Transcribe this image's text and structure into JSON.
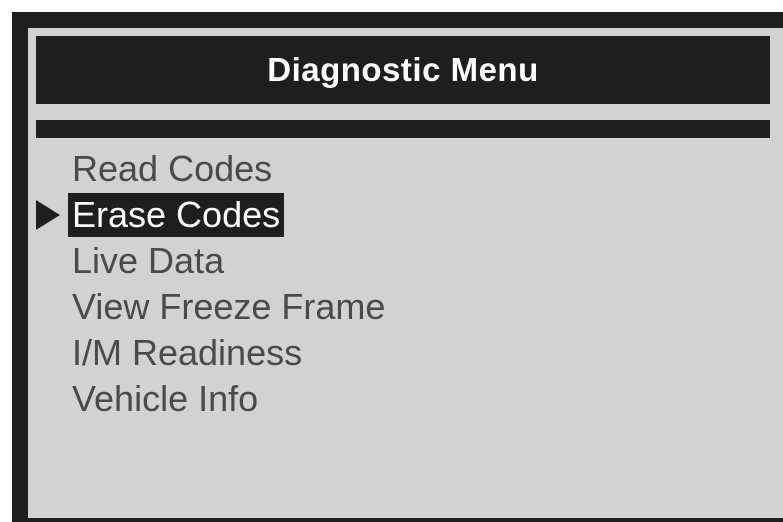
{
  "header": {
    "title": "Diagnostic Menu"
  },
  "menu": {
    "selected_index": 1,
    "items": [
      {
        "label": "Read Codes"
      },
      {
        "label": "Erase Codes"
      },
      {
        "label": "Live Data"
      },
      {
        "label": "View Freeze Frame"
      },
      {
        "label": "I/M Readiness"
      },
      {
        "label": "Vehicle Info"
      }
    ]
  },
  "colors": {
    "bezel": "#1e1e1e",
    "screen_background": "#d1d2d4",
    "text": "#4a4a4a",
    "highlight_background": "#1e1e1e",
    "highlight_text": "#ffffff"
  },
  "icons": {
    "selection_pointer": "right-pointing-triangle-icon"
  }
}
